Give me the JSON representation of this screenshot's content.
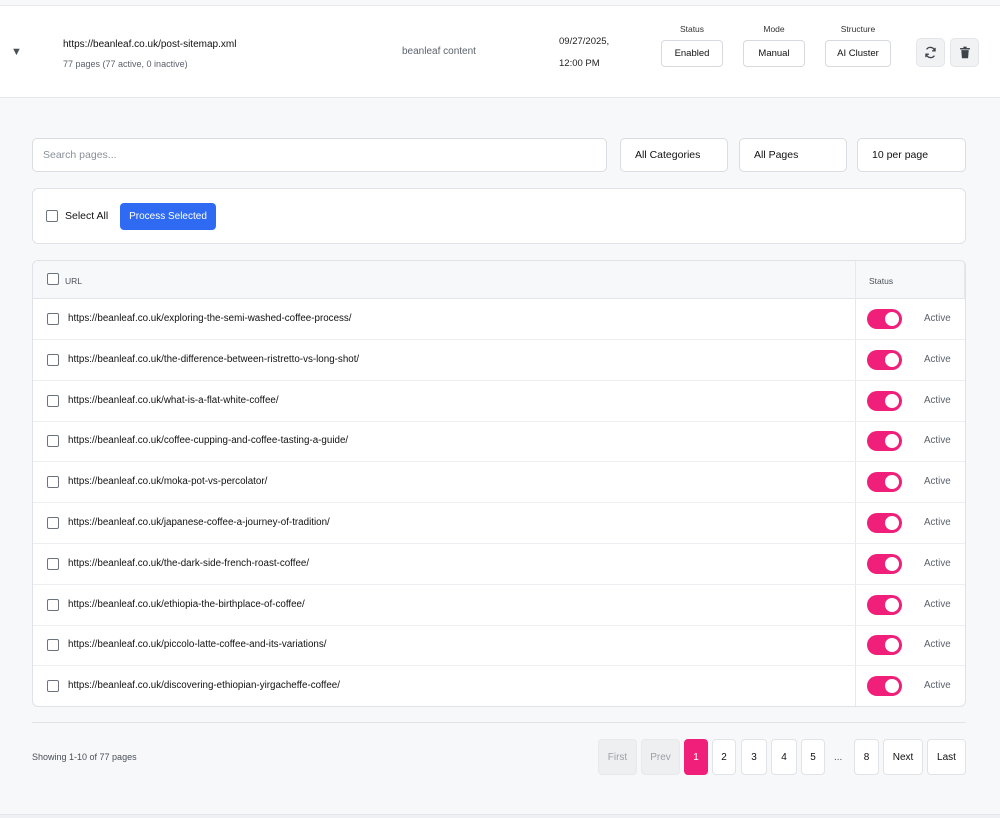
{
  "sitemap": {
    "url": "https://beanleaf.co.uk/post-sitemap.xml",
    "count": "77 pages (77 active, 0 inactive)",
    "category": "beanleaf content",
    "date": "09/27/2025,",
    "time": "12:00 PM",
    "status_label": "Status",
    "status_value": "Enabled",
    "mode_label": "Mode",
    "mode_value": "Manual",
    "structure_label": "Structure",
    "structure_value": "AI Cluster"
  },
  "filters": {
    "search_placeholder": "Search pages...",
    "category": "All Categories",
    "pages": "All Pages",
    "per_page": "10 per page"
  },
  "bulk": {
    "select_all": "Select All",
    "process_selected": "Process Selected"
  },
  "table": {
    "url_header": "URL",
    "status_header": "Status",
    "rows": [
      {
        "url": "https://beanleaf.co.uk/exploring-the-semi-washed-coffee-process/",
        "status": "Active"
      },
      {
        "url": "https://beanleaf.co.uk/the-difference-between-ristretto-vs-long-shot/",
        "status": "Active"
      },
      {
        "url": "https://beanleaf.co.uk/what-is-a-flat-white-coffee/",
        "status": "Active"
      },
      {
        "url": "https://beanleaf.co.uk/coffee-cupping-and-coffee-tasting-a-guide/",
        "status": "Active"
      },
      {
        "url": "https://beanleaf.co.uk/moka-pot-vs-percolator/",
        "status": "Active"
      },
      {
        "url": "https://beanleaf.co.uk/japanese-coffee-a-journey-of-tradition/",
        "status": "Active"
      },
      {
        "url": "https://beanleaf.co.uk/the-dark-side-french-roast-coffee/",
        "status": "Active"
      },
      {
        "url": "https://beanleaf.co.uk/ethiopia-the-birthplace-of-coffee/",
        "status": "Active"
      },
      {
        "url": "https://beanleaf.co.uk/piccolo-latte-coffee-and-its-variations/",
        "status": "Active"
      },
      {
        "url": "https://beanleaf.co.uk/discovering-ethiopian-yirgacheffe-coffee/",
        "status": "Active"
      }
    ]
  },
  "pagination": {
    "showing": "Showing 1-10 of 77 pages",
    "first": "First",
    "prev": "Prev",
    "pages": [
      "1",
      "2",
      "3",
      "4",
      "5"
    ],
    "ellipsis": "...",
    "last_page": "8",
    "next": "Next",
    "last": "Last"
  },
  "colors": {
    "accent_pink": "#f0207a",
    "primary_blue": "#2f6bf2"
  }
}
